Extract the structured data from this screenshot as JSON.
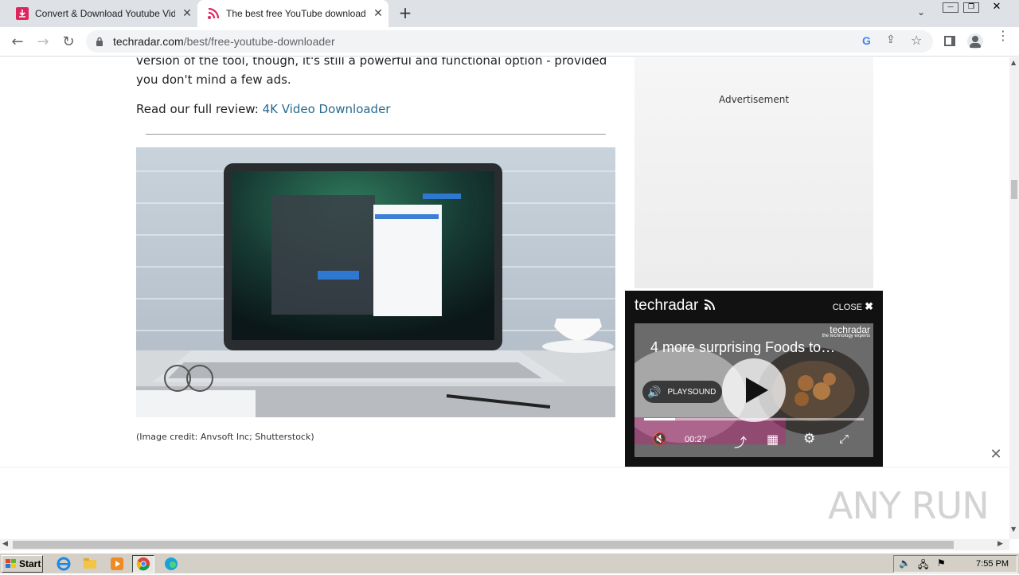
{
  "browser": {
    "tabs": [
      {
        "title": "Convert & Download Youtube Videos",
        "favicon": "download-icon"
      },
      {
        "title": "The best free YouTube downloader app",
        "favicon": "rss-icon"
      }
    ],
    "new_tab": "+",
    "url_host": "techradar.com",
    "url_path": "/best/free-youtube-downloader"
  },
  "article": {
    "paragraph": "version of the tool, though, it's still a powerful and functional option - provided you don't mind a few ads.",
    "read_prefix": "Read our full review: ",
    "read_link": "4K Video Downloader",
    "image_credit": "(Image credit: Anvsoft Inc; Shutterstock)"
  },
  "sidebar": {
    "ad_label": "Advertisement"
  },
  "video": {
    "logo": "techradar",
    "close_label": "CLOSE",
    "title": "4 more surprising Foods to…",
    "playsound_label": "PLAYSOUND",
    "time": "00:27",
    "progress": 0.14,
    "brand_corner": "techradar",
    "brand_tagline": "the technology experts"
  },
  "watermark": "ANY RUN",
  "taskbar": {
    "start_label": "Start",
    "clock": "7:55 PM"
  },
  "colors": {
    "link": "#276a8c",
    "tab_active": "#ffffff",
    "tab_strip": "#dee1e6"
  }
}
